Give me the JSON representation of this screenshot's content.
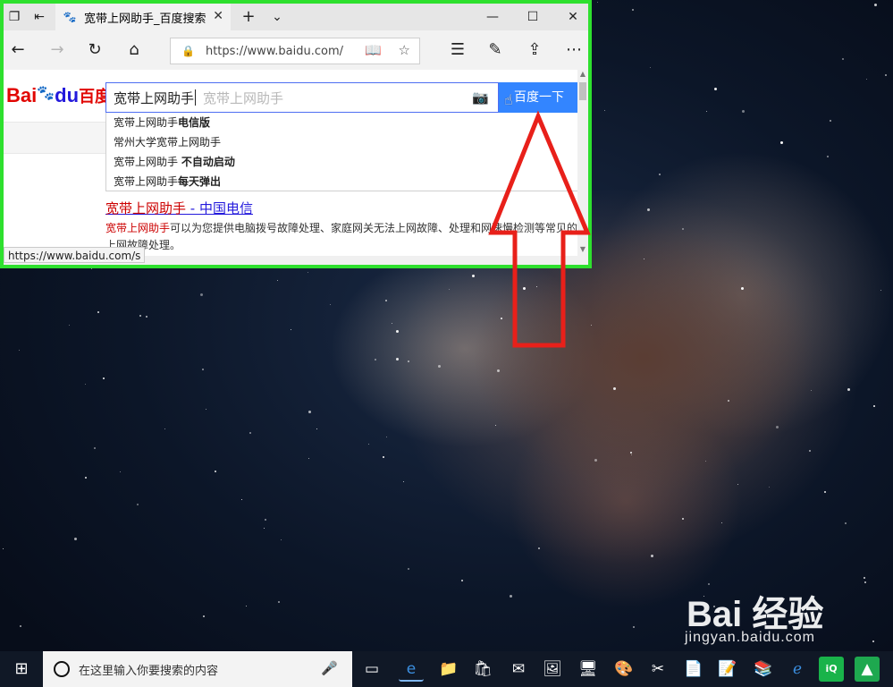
{
  "tab": {
    "title": "宽带上网助手_百度搜索"
  },
  "address_bar": {
    "url": "https://www.baidu.com/"
  },
  "baidu": {
    "logo_latin_1": "Bai",
    "logo_latin_2": "du",
    "logo_cn": "百度",
    "query": "宽带上网助手",
    "placeholder": "宽带上网助手",
    "search_button": "百度一下"
  },
  "suggestions": [
    {
      "prefix": "宽带上网助手",
      "bold": "电信版"
    },
    {
      "prefix": "常州大学宽带上网助手",
      "bold": ""
    },
    {
      "prefix": "宽带上网助手 ",
      "bold": "不自动启动"
    },
    {
      "prefix": "宽带上网助手",
      "bold": "每天弹出"
    }
  ],
  "result": {
    "title_highlight": "宽带上网助手",
    "title_rest": " - 中国电信",
    "desc_highlight": "宽带上网助手",
    "desc_rest": "可以为您提供电脑拨号故障处理、家庭网关无法上网故障、处理和网速慢检测等常见的上网故障处理。"
  },
  "status_url": "https://www.baidu.com/s",
  "watermark": {
    "main": "Bai 经验",
    "sub": "jingyan.baidu.com"
  },
  "taskbar": {
    "search_placeholder": "在这里输入你要搜索的内容"
  },
  "colors": {
    "highlight_border": "#2ee02e",
    "annotation_arrow": "#e8201a",
    "baidu_blue": "#3385ff"
  }
}
